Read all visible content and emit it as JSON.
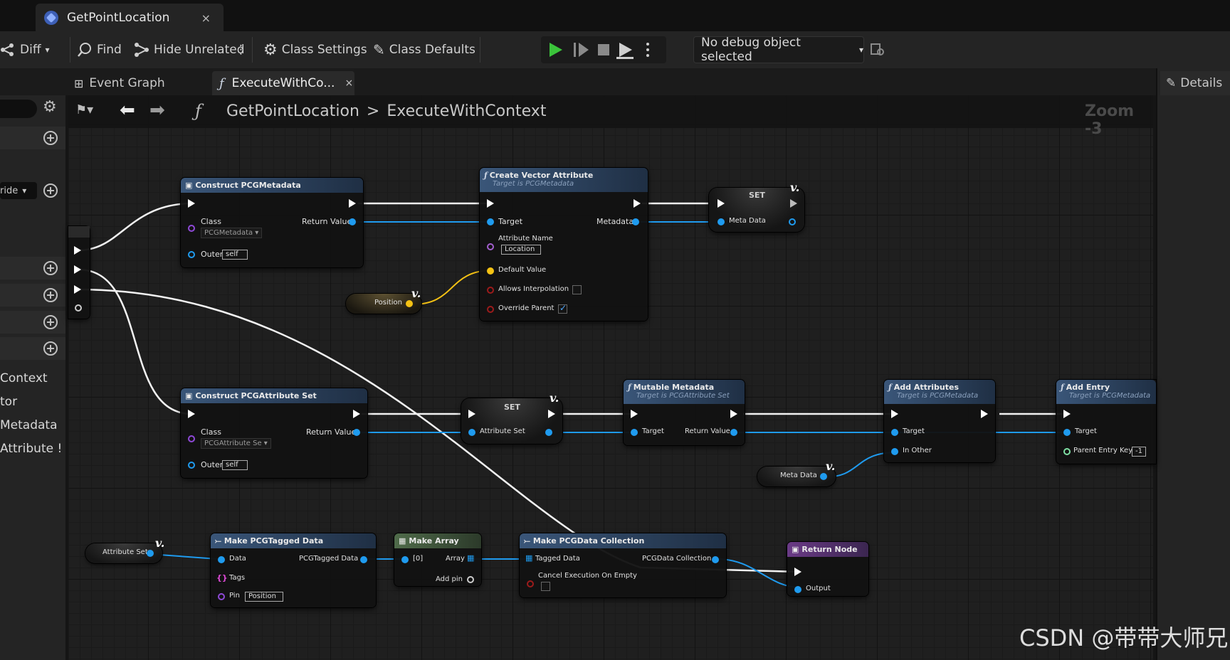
{
  "window": {
    "doc_tab": "GetPointLocation",
    "close": "×"
  },
  "toolbar": {
    "diff": "Diff",
    "find": "Find",
    "hide_unrelated": "Hide Unrelated",
    "class_settings": "Class Settings",
    "class_defaults": "Class Defaults",
    "debug_object": "No debug object selected"
  },
  "tabs": {
    "event_graph": "Event Graph",
    "execute": "ExecuteWithCo...",
    "details": "Details"
  },
  "breadcrumb": {
    "root": "GetPointLocation",
    "sep": ">",
    "leaf": "ExecuteWithContext",
    "zoom": "Zoom -3"
  },
  "left_panel": {
    "override_label": "ride",
    "items": [
      "Context",
      "tor",
      "Metadata",
      "Attribute !"
    ]
  },
  "nodes": {
    "construct_meta": {
      "title": "Construct PCGMetadata",
      "class": "Class",
      "class_val": "PCGMetadata",
      "return": "Return Value",
      "outer": "Outer",
      "outer_val": "self"
    },
    "create_vector": {
      "title": "Create Vector Attribute",
      "sub": "Target is PCGMetadata",
      "target": "Target",
      "metadata": "Metadata",
      "attr_name": "Attribute Name",
      "attr_val": "Location",
      "default": "Default Value",
      "interp": "Allows Interpolation",
      "override": "Override Parent"
    },
    "set_meta": {
      "title": "SET",
      "pin": "Meta Data"
    },
    "position": {
      "label": "Position"
    },
    "construct_attr": {
      "title": "Construct PCGAttribute Set",
      "class": "Class",
      "class_val": "PCGAttribute Se",
      "return": "Return Value",
      "outer": "Outer",
      "outer_val": "self"
    },
    "set_attr": {
      "title": "SET",
      "pin": "Attribute Set"
    },
    "mutable_meta": {
      "title": "Mutable Metadata",
      "sub": "Target is PCGAttribute Set",
      "target": "Target",
      "return": "Return Value"
    },
    "add_attrs": {
      "title": "Add Attributes",
      "sub": "Target is PCGMetadata",
      "target": "Target",
      "in_other": "In Other"
    },
    "add_entry": {
      "title": "Add Entry",
      "sub": "Target is PCGMetadata",
      "target": "Target",
      "parent": "Parent Entry Key",
      "parent_val": "-1"
    },
    "meta_data_get": {
      "label": "Meta Data"
    },
    "attr_set_get": {
      "label": "Attribute Set"
    },
    "make_tagged": {
      "title": "Make PCGTagged Data",
      "data": "Data",
      "out": "PCGTagged Data",
      "tags": "Tags",
      "pin": "Pin",
      "pin_val": "Position"
    },
    "make_array": {
      "title": "Make Array",
      "in0": "[0]",
      "array": "Array",
      "add_pin": "Add pin"
    },
    "make_collection": {
      "title": "Make PCGData Collection",
      "tagged": "Tagged Data",
      "out": "PCGData Collection",
      "cancel": "Cancel Execution On Empty"
    },
    "return_node": {
      "title": "Return Node",
      "output": "Output"
    }
  },
  "watermark": "CSDN @带带大师兄",
  "colors": {
    "exec": "#ffffff",
    "object": "#1f9bef",
    "vector": "#f5c214",
    "name": "#a35fcf",
    "bool": "#9c1b1b"
  }
}
